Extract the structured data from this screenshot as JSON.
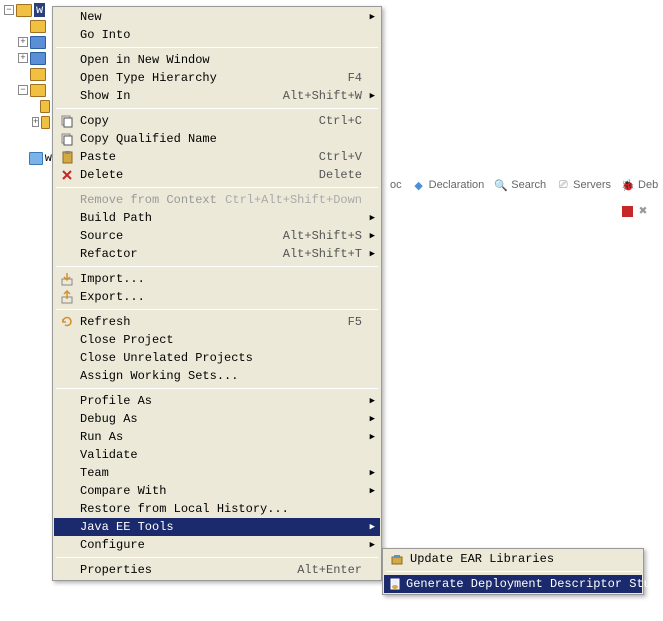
{
  "tree": {
    "selected_label": "w"
  },
  "menu": [
    {
      "label": "New",
      "shortcut": "",
      "arrow": true
    },
    {
      "label": "Go Into",
      "shortcut": ""
    },
    {
      "sep": true
    },
    {
      "label": "Open in New Window",
      "shortcut": ""
    },
    {
      "label": "Open Type Hierarchy",
      "shortcut": "F4"
    },
    {
      "label": "Show In",
      "shortcut": "Alt+Shift+W",
      "arrow": true
    },
    {
      "sep": true
    },
    {
      "label": "Copy",
      "shortcut": "Ctrl+C",
      "icon": "copy"
    },
    {
      "label": "Copy Qualified Name",
      "shortcut": "",
      "icon": "copy"
    },
    {
      "label": "Paste",
      "shortcut": "Ctrl+V",
      "icon": "paste"
    },
    {
      "label": "Delete",
      "shortcut": "Delete",
      "icon": "delete"
    },
    {
      "sep": true
    },
    {
      "label": "Remove from Context",
      "shortcut": "Ctrl+Alt+Shift+Down",
      "disabled": true
    },
    {
      "label": "Build Path",
      "shortcut": "",
      "arrow": true
    },
    {
      "label": "Source",
      "shortcut": "Alt+Shift+S",
      "arrow": true
    },
    {
      "label": "Refactor",
      "shortcut": "Alt+Shift+T",
      "arrow": true
    },
    {
      "sep": true
    },
    {
      "label": "Import...",
      "shortcut": "",
      "icon": "import"
    },
    {
      "label": "Export...",
      "shortcut": "",
      "icon": "export"
    },
    {
      "sep": true
    },
    {
      "label": "Refresh",
      "shortcut": "F5",
      "icon": "refresh"
    },
    {
      "label": "Close Project",
      "shortcut": ""
    },
    {
      "label": "Close Unrelated Projects",
      "shortcut": ""
    },
    {
      "label": "Assign Working Sets...",
      "shortcut": ""
    },
    {
      "sep": true
    },
    {
      "label": "Profile As",
      "shortcut": "",
      "arrow": true
    },
    {
      "label": "Debug As",
      "shortcut": "",
      "arrow": true
    },
    {
      "label": "Run As",
      "shortcut": "",
      "arrow": true
    },
    {
      "label": "Validate",
      "shortcut": ""
    },
    {
      "label": "Team",
      "shortcut": "",
      "arrow": true
    },
    {
      "label": "Compare With",
      "shortcut": "",
      "arrow": true
    },
    {
      "label": "Restore from Local History...",
      "shortcut": ""
    },
    {
      "label": "Java EE Tools",
      "shortcut": "",
      "arrow": true,
      "highlighted": true
    },
    {
      "label": "Configure",
      "shortcut": "",
      "arrow": true
    },
    {
      "sep": true
    },
    {
      "label": "Properties",
      "shortcut": "Alt+Enter"
    }
  ],
  "submenu": [
    {
      "label": "Update EAR Libraries",
      "icon": "ear"
    },
    {
      "sep": true
    },
    {
      "label": "Generate Deployment Descriptor Stub",
      "icon": "dd",
      "highlighted": true
    }
  ],
  "bg_tabs": [
    {
      "label": "oc",
      "icon_color": "#888"
    },
    {
      "label": "Declaration",
      "icon_color": "#4a90d9"
    },
    {
      "label": "Search",
      "icon_color": "#e8a33d"
    },
    {
      "label": "Servers",
      "icon_color": "#888"
    },
    {
      "label": "Deb",
      "icon_color": "#6ab04c"
    }
  ]
}
